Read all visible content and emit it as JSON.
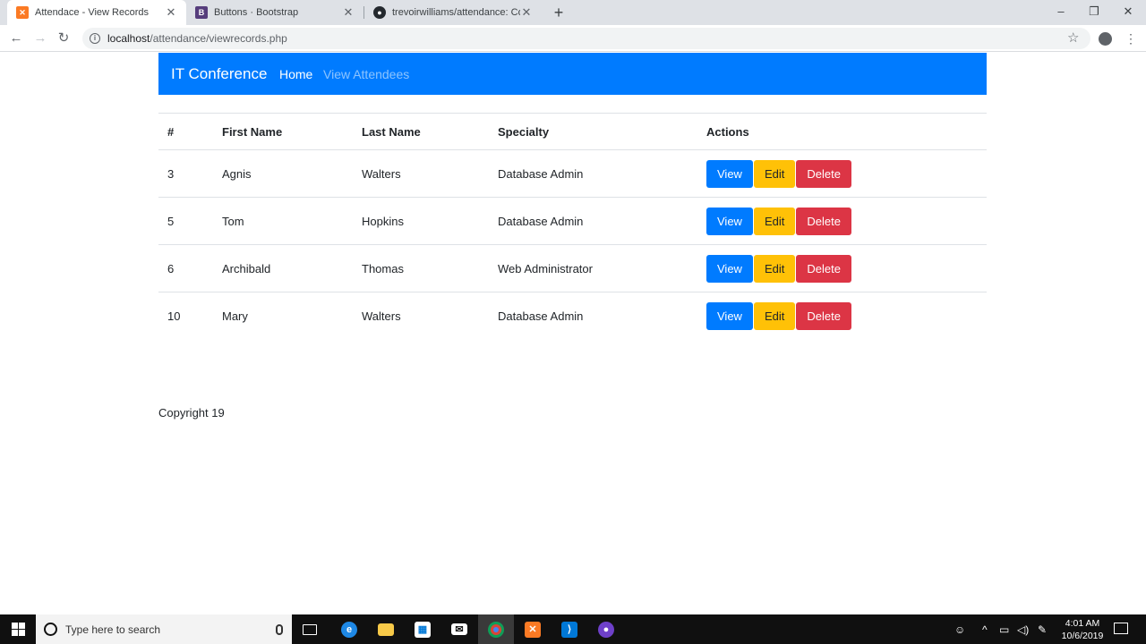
{
  "browser": {
    "tabs": [
      {
        "title": "Attendace - View Records",
        "favicon": "xampp-icon",
        "color": "#fb7a24"
      },
      {
        "title": "Buttons · Bootstrap",
        "favicon": "bootstrap-icon",
        "color": "#563d7c"
      },
      {
        "title": "trevoirwilliams/attendance: Code",
        "favicon": "github-icon",
        "color": "#24292e"
      }
    ],
    "url_host": "localhost",
    "url_path": "/attendance/viewrecords.php"
  },
  "navbar": {
    "brand": "IT Conference",
    "links": [
      {
        "label": "Home"
      },
      {
        "label": "View Attendees"
      }
    ],
    "color": "#007bff"
  },
  "table": {
    "headers": [
      "#",
      "First Name",
      "Last Name",
      "Specialty",
      "Actions"
    ],
    "rows": [
      {
        "id": "3",
        "first": "Agnis",
        "last": "Walters",
        "specialty": "Database Admin"
      },
      {
        "id": "5",
        "first": "Tom",
        "last": "Hopkins",
        "specialty": "Database Admin"
      },
      {
        "id": "6",
        "first": "Archibald",
        "last": "Thomas",
        "specialty": "Web Administrator"
      },
      {
        "id": "10",
        "first": "Mary",
        "last": "Walters",
        "specialty": "Database Admin"
      }
    ],
    "actions": {
      "view": "View",
      "edit": "Edit",
      "delete": "Delete"
    }
  },
  "footer": {
    "text": "Copyright 19"
  },
  "taskbar": {
    "search_placeholder": "Type here to search",
    "time": "4:01 AM",
    "date": "10/6/2019",
    "apps": [
      "task-view-icon",
      "edge-icon",
      "file-explorer-icon",
      "store-icon",
      "mail-icon",
      "chrome-icon",
      "xampp-icon",
      "vscode-icon",
      "github-desktop-icon"
    ]
  }
}
